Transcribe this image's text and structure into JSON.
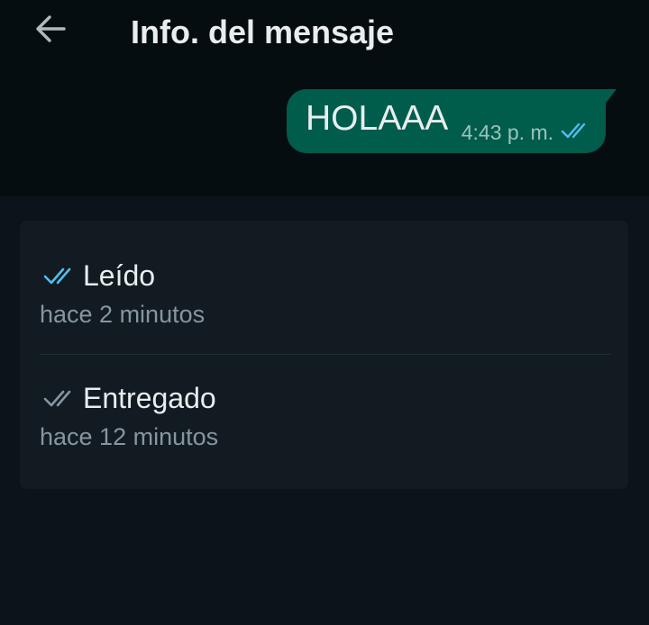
{
  "header": {
    "title": "Info. del mensaje",
    "back_icon": "arrow-left-icon"
  },
  "message": {
    "text": "HOLAAA",
    "time": "4:43 p. m.",
    "status_icon": "double-check-read-icon"
  },
  "statuses": [
    {
      "label": "Leído",
      "time": "hace 2 minutos",
      "icon": "double-check-read-icon",
      "icon_color": "#53bdeb"
    },
    {
      "label": "Entregado",
      "time": "hace 12 minutos",
      "icon": "double-check-delivered-icon",
      "icon_color": "#8696a0"
    }
  ],
  "colors": {
    "background": "#0b141a",
    "chat_background": "#060d10",
    "bubble": "#005c4b",
    "card": "#111b21",
    "read_check": "#53bdeb",
    "delivered_check": "#8696a0"
  }
}
